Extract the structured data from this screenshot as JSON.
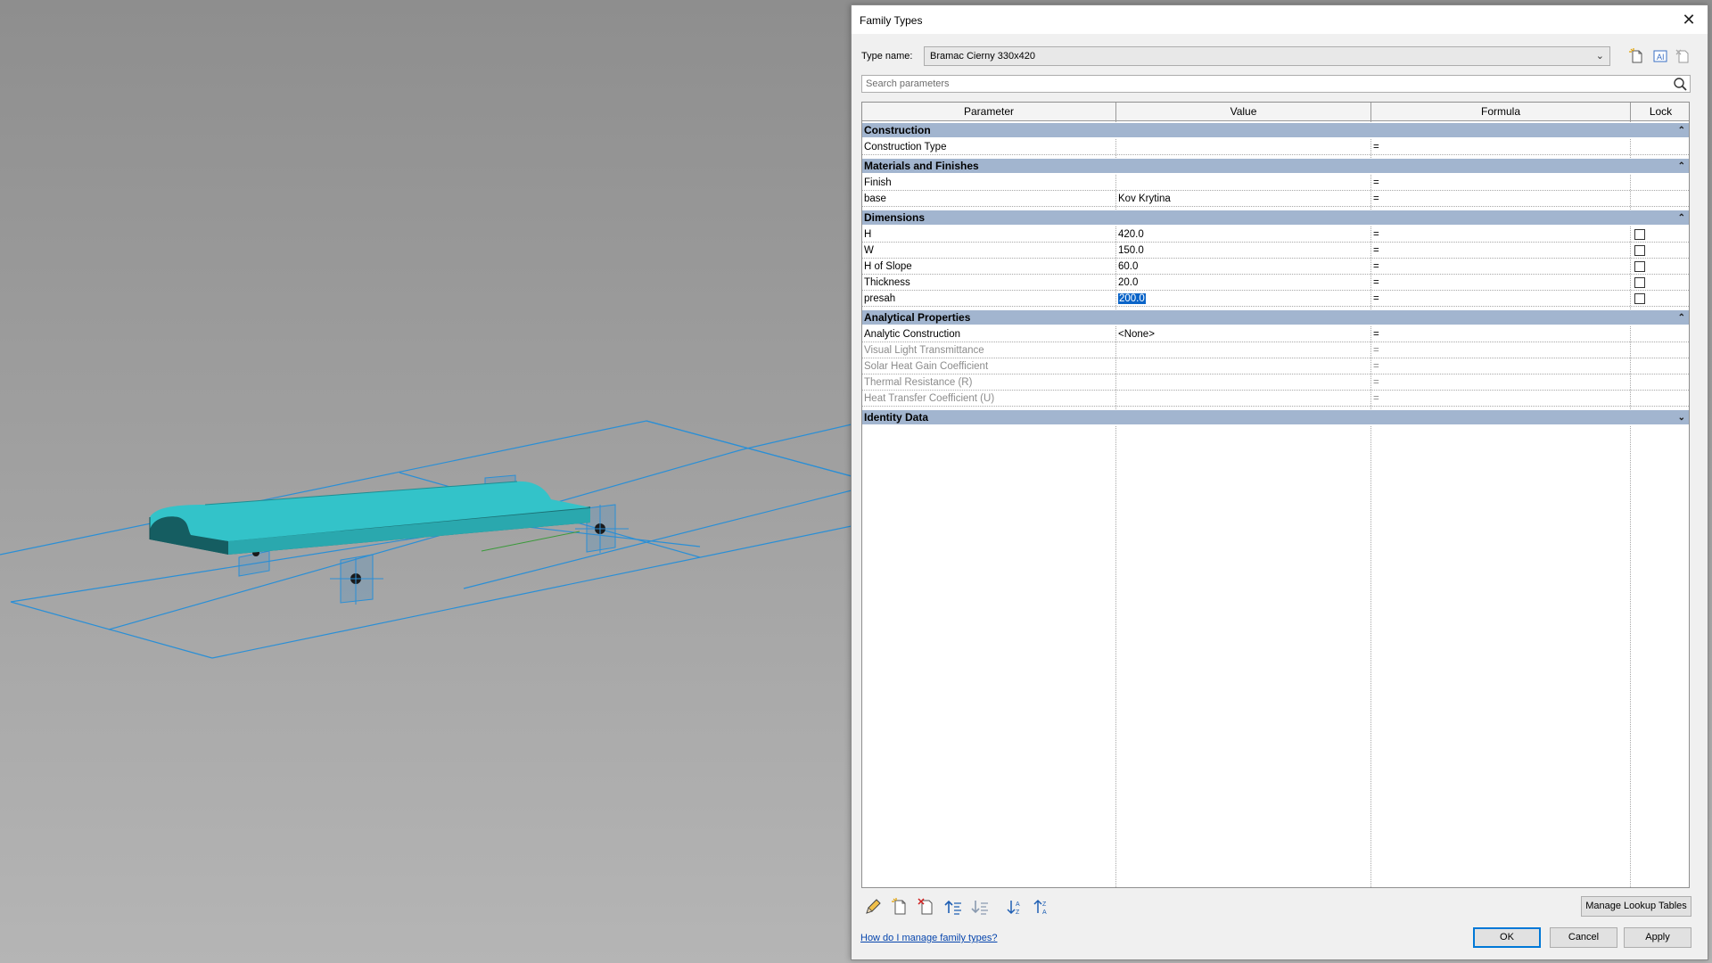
{
  "dialog": {
    "title": "Family Types",
    "close_glyph": "✕",
    "type_name_label": "Type name:",
    "type_name_value": "Bramac Cierny 330x420",
    "search_placeholder": "Search parameters",
    "columns": [
      "Parameter",
      "Value",
      "Formula",
      "Lock"
    ],
    "groups": [
      {
        "name": "Construction",
        "collapse_glyph": "⌃",
        "rows": [
          {
            "param": "Construction Type",
            "value": "",
            "formula": "=",
            "lock": false,
            "disabled": false
          }
        ]
      },
      {
        "name": "Materials and Finishes",
        "collapse_glyph": "⌃",
        "rows": [
          {
            "param": "Finish",
            "value": "",
            "formula": "=",
            "lock": false,
            "disabled": false
          },
          {
            "param": "base",
            "value": "Kov Krytina",
            "formula": "=",
            "lock": false,
            "disabled": false
          }
        ]
      },
      {
        "name": "Dimensions",
        "collapse_glyph": "⌃",
        "rows": [
          {
            "param": "H",
            "value": "420.0",
            "formula": "=",
            "lock": true,
            "disabled": false
          },
          {
            "param": "W",
            "value": "150.0",
            "formula": "=",
            "lock": true,
            "disabled": false
          },
          {
            "param": "H of Slope",
            "value": "60.0",
            "formula": "=",
            "lock": true,
            "disabled": false
          },
          {
            "param": "Thickness",
            "value": "20.0",
            "formula": "=",
            "lock": true,
            "disabled": false
          },
          {
            "param": "presah",
            "value": "200.0",
            "formula": "=",
            "lock": true,
            "disabled": false,
            "selected": true
          }
        ]
      },
      {
        "name": "Analytical Properties",
        "collapse_glyph": "⌃",
        "rows": [
          {
            "param": "Analytic Construction",
            "value": "<None>",
            "formula": "=",
            "lock": false,
            "disabled": false
          },
          {
            "param": "Visual Light Transmittance",
            "value": "",
            "formula": "=",
            "lock": false,
            "disabled": true
          },
          {
            "param": "Solar Heat Gain Coefficient",
            "value": "",
            "formula": "=",
            "lock": false,
            "disabled": true
          },
          {
            "param": "Thermal Resistance (R)",
            "value": "",
            "formula": "=",
            "lock": false,
            "disabled": true
          },
          {
            "param": "Heat Transfer Coefficient (U)",
            "value": "",
            "formula": "=",
            "lock": false,
            "disabled": true
          }
        ]
      },
      {
        "name": "Identity Data",
        "collapse_glyph": "⌄",
        "rows": []
      }
    ],
    "manage_lookup_label": "Manage Lookup Tables",
    "help_link": "How do I manage family types?",
    "ok_label": "OK",
    "cancel_label": "Cancel",
    "apply_label": "Apply",
    "icons": {
      "new_type": "new-type-icon",
      "rename_type": "rename-type-icon",
      "delete_type": "delete-type-icon",
      "search": "search-icon",
      "edit_parameter": "pencil-icon",
      "new_parameter": "new-parameter-icon",
      "delete_parameter": "delete-parameter-icon",
      "move_up": "move-up-icon",
      "move_down": "move-down-icon",
      "sort_ascending": "sort-ascending-icon",
      "sort_descending": "sort-descending-icon"
    },
    "colors": {
      "group_header": "#a2b5cf",
      "selection": "#0a64c8",
      "model": "#2fb9c1",
      "reference_lines": "#2a8fd6"
    }
  }
}
